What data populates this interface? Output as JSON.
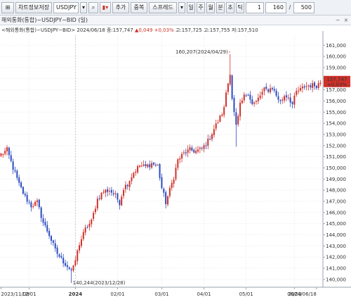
{
  "toolbar": {
    "icon1": "⊞",
    "chart_setting": "차트정보저장",
    "symbol": "USDJPY",
    "dropdown": "▾",
    "search": "⌕",
    "indicator": "▮▾",
    "add": "추가",
    "overlap": "중복",
    "spread": "스프레드",
    "dropdown2": "▾",
    "periods": [
      "일",
      "주",
      "월",
      "분",
      "초",
      "틱"
    ],
    "period_value": "1",
    "count": "160",
    "slash": "/",
    "total": "500"
  },
  "panel": {
    "title": "해외통화(통합)−USDJPY−BID (일)",
    "info_prefix": "<해외통화(통합)−USDJPY−BID> 2024/06/18 종:157,747",
    "info_change": "▲0,049  +0,03%",
    "info_suffix": "고:157,725 고:157,755 저:157,510",
    "minimize": "−",
    "close": "×"
  },
  "chart_data": {
    "type": "candlestick",
    "symbol": "USDJPY",
    "x_tick_labels": [
      "2023/11/08",
      "12/01",
      "2024",
      "02/01",
      "03/01",
      "04/01",
      "05/01",
      "06/03",
      "2024/06/18"
    ],
    "y_tick_labels": [
      "140,000",
      "141,000",
      "142,000",
      "143,000",
      "144,000",
      "145,000",
      "146,000",
      "147,000",
      "148,000",
      "149,000",
      "150,000",
      "151,000",
      "152,000",
      "153,000",
      "154,000",
      "155,000",
      "156,000",
      "157,000",
      "158,000",
      "159,000",
      "160,000",
      "161,000"
    ],
    "ylim": [
      139.3,
      161.9
    ],
    "high_annotation": "160,207(2024/04/29)",
    "low_annotation": "140,244(2023/12/28)",
    "current_price": "157,747",
    "current_change": "+0,03%",
    "bar_count": 160,
    "anchors": [
      [
        0,
        151.2
      ],
      [
        3,
        151.6
      ],
      [
        6,
        150.0
      ],
      [
        9,
        148.5
      ],
      [
        12,
        147.4
      ],
      [
        15,
        146.6
      ],
      [
        18,
        146.9
      ],
      [
        21,
        145.1
      ],
      [
        24,
        144.0
      ],
      [
        27,
        142.6
      ],
      [
        30,
        141.8
      ],
      [
        33,
        141.2
      ],
      [
        35,
        140.8
      ],
      [
        36,
        141.0
      ],
      [
        39,
        143.2
      ],
      [
        42,
        144.5
      ],
      [
        45,
        145.2
      ],
      [
        48,
        147.2
      ],
      [
        51,
        147.9
      ],
      [
        54,
        148.0
      ],
      [
        57,
        147.5
      ],
      [
        59,
        146.9
      ],
      [
        61,
        148.2
      ],
      [
        63,
        148.6
      ],
      [
        66,
        149.6
      ],
      [
        69,
        150.2
      ],
      [
        72,
        150.1
      ],
      [
        75,
        150.4
      ],
      [
        78,
        150.2
      ],
      [
        80,
        148.2
      ],
      [
        82,
        146.9
      ],
      [
        84,
        148.0
      ],
      [
        86,
        149.2
      ],
      [
        88,
        150.7
      ],
      [
        91,
        151.3
      ],
      [
        94,
        151.6
      ],
      [
        97,
        151.5
      ],
      [
        100,
        151.7
      ],
      [
        103,
        152.4
      ],
      [
        106,
        153.5
      ],
      [
        109,
        154.5
      ],
      [
        111,
        155.3
      ],
      [
        112,
        156.8
      ],
      [
        113,
        157.6
      ],
      [
        114,
        158.6
      ],
      [
        115,
        156.3
      ],
      [
        116,
        154.9
      ],
      [
        117,
        153.7
      ],
      [
        118,
        154.5
      ],
      [
        119,
        155.6
      ],
      [
        121,
        156.4
      ],
      [
        123,
        156.8
      ],
      [
        125,
        155.7
      ],
      [
        127,
        155.9
      ],
      [
        129,
        156.5
      ],
      [
        131,
        157.0
      ],
      [
        133,
        157.0
      ],
      [
        135,
        157.2
      ],
      [
        137,
        156.5
      ],
      [
        139,
        155.9
      ],
      [
        141,
        156.5
      ],
      [
        143,
        156.4
      ],
      [
        145,
        155.7
      ],
      [
        147,
        156.8
      ],
      [
        149,
        157.0
      ],
      [
        151,
        157.3
      ],
      [
        153,
        157.4
      ],
      [
        155,
        157.4
      ],
      [
        157,
        157.4
      ],
      [
        159,
        157.7
      ]
    ],
    "special_highs": [
      [
        114,
        160.2
      ],
      [
        35,
        140.244
      ],
      [
        117,
        151.9
      ]
    ],
    "up_color": "#d0302a",
    "down_color": "#2b4bbf",
    "grid": true
  }
}
